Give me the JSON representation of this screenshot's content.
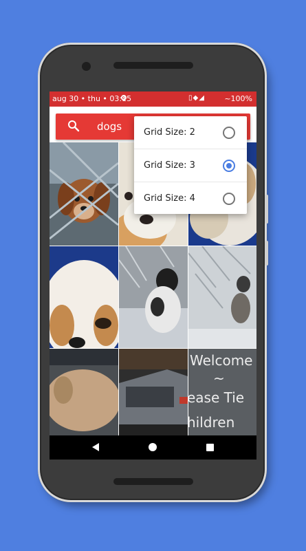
{
  "status_bar": {
    "datetime": "aug 30 • thu • 03:15",
    "signal_icons": "▯◆◢",
    "battery": "~100%"
  },
  "search": {
    "query": "dogs",
    "icon": "search-icon",
    "accent_color": "#e53935"
  },
  "grid_menu": {
    "items": [
      {
        "label": "Grid Size: 2",
        "selected": false
      },
      {
        "label": "Grid Size: 3",
        "selected": true
      },
      {
        "label": "Grid Size: 4",
        "selected": false
      }
    ]
  },
  "photos": [
    {
      "subject": "puppy-behind-fence"
    },
    {
      "subject": "white-dog-closeup"
    },
    {
      "subject": "fluffy-dog"
    },
    {
      "subject": "shih-tzu-face"
    },
    {
      "subject": "dog-in-snow"
    },
    {
      "subject": "dog-in-snowy-forest"
    },
    {
      "subject": "tan-dog"
    },
    {
      "subject": "pickup-truck"
    },
    {
      "subject": "welcome-sign"
    }
  ],
  "welcome_sign": {
    "line1": "Welcome",
    "line2": "~",
    "line3": "ease Tie",
    "line4": "hildren"
  },
  "nav_bar": {
    "back_icon": "back-triangle-icon",
    "home_icon": "home-circle-icon",
    "recents_icon": "recents-square-icon"
  },
  "colors": {
    "background": "#4f7fe0",
    "status_bar": "#d32f2f",
    "radio_selected": "#4a7de2"
  }
}
